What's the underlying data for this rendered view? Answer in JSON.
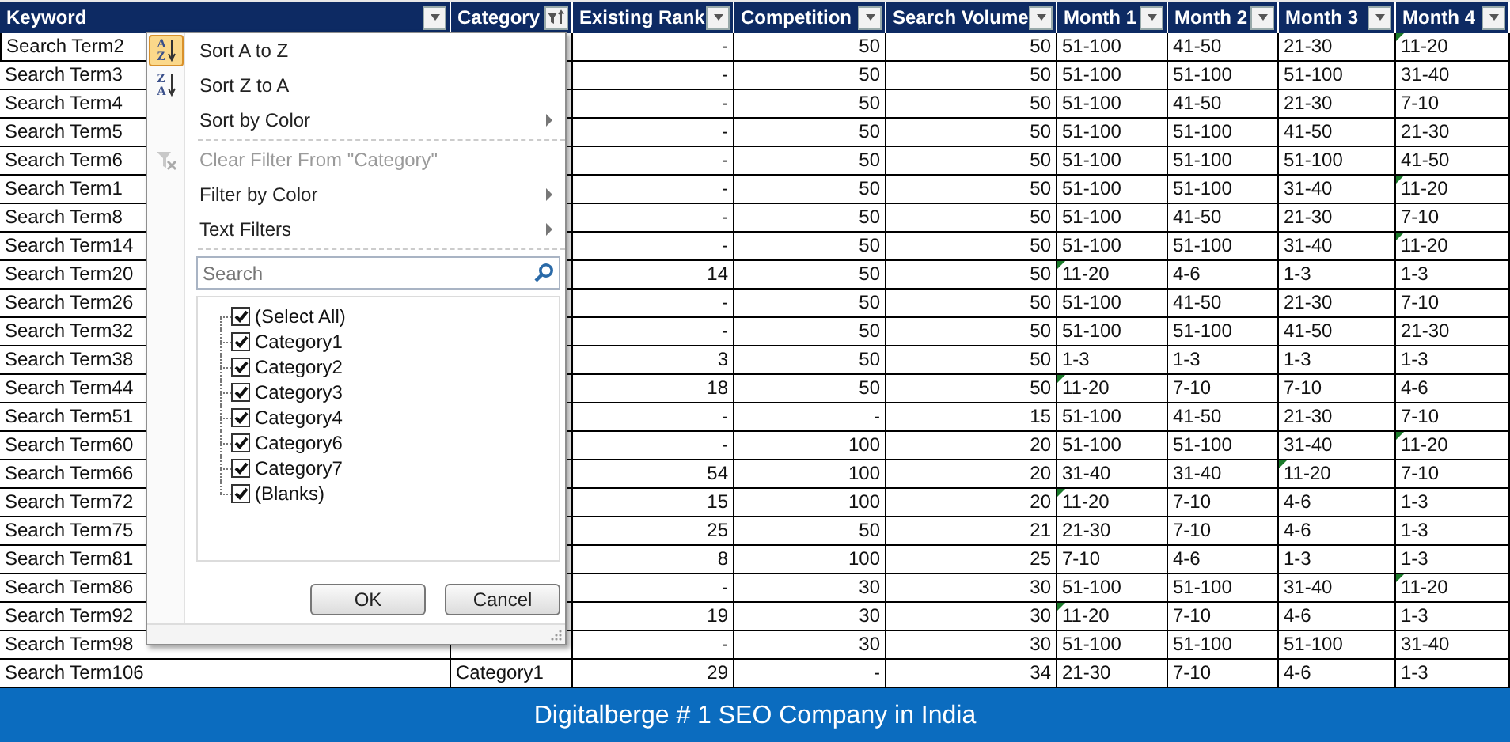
{
  "columns": [
    {
      "label": "Keyword",
      "filtered": false
    },
    {
      "label": "Category",
      "filtered": true
    },
    {
      "label": "Existing Rank",
      "filtered": false
    },
    {
      "label": "Competition",
      "filtered": false
    },
    {
      "label": "Search Volume",
      "filtered": false
    },
    {
      "label": "Month 1",
      "filtered": false
    },
    {
      "label": "Month 2",
      "filtered": false
    },
    {
      "label": "Month 3",
      "filtered": false
    },
    {
      "label": "Month 4",
      "filtered": false
    }
  ],
  "rows": [
    {
      "keyword": "Search Term2",
      "rank": "-",
      "competition": "50",
      "volume": "50",
      "months": [
        {
          "text": "51-100",
          "flagged": false
        },
        {
          "text": "41-50",
          "flagged": false
        },
        {
          "text": "21-30",
          "flagged": false
        },
        {
          "text": "11-20",
          "flagged": true
        }
      ]
    },
    {
      "keyword": "Search Term3",
      "rank": "-",
      "competition": "50",
      "volume": "50",
      "months": [
        {
          "text": "51-100",
          "flagged": false
        },
        {
          "text": "51-100",
          "flagged": false
        },
        {
          "text": "51-100",
          "flagged": false
        },
        {
          "text": "31-40",
          "flagged": false
        }
      ]
    },
    {
      "keyword": "Search Term4",
      "rank": "-",
      "competition": "50",
      "volume": "50",
      "months": [
        {
          "text": "51-100",
          "flagged": false
        },
        {
          "text": "41-50",
          "flagged": false
        },
        {
          "text": "21-30",
          "flagged": false
        },
        {
          "text": "7-10",
          "flagged": false
        }
      ]
    },
    {
      "keyword": "Search Term5",
      "rank": "-",
      "competition": "50",
      "volume": "50",
      "months": [
        {
          "text": "51-100",
          "flagged": false
        },
        {
          "text": "51-100",
          "flagged": false
        },
        {
          "text": "41-50",
          "flagged": false
        },
        {
          "text": "21-30",
          "flagged": false
        }
      ]
    },
    {
      "keyword": "Search Term6",
      "rank": "-",
      "competition": "50",
      "volume": "50",
      "months": [
        {
          "text": "51-100",
          "flagged": false
        },
        {
          "text": "51-100",
          "flagged": false
        },
        {
          "text": "51-100",
          "flagged": false
        },
        {
          "text": "41-50",
          "flagged": false
        }
      ]
    },
    {
      "keyword": "Search Term1",
      "rank": "-",
      "competition": "50",
      "volume": "50",
      "months": [
        {
          "text": "51-100",
          "flagged": false
        },
        {
          "text": "51-100",
          "flagged": false
        },
        {
          "text": "31-40",
          "flagged": false
        },
        {
          "text": "11-20",
          "flagged": true
        }
      ]
    },
    {
      "keyword": "Search Term8",
      "rank": "-",
      "competition": "50",
      "volume": "50",
      "months": [
        {
          "text": "51-100",
          "flagged": false
        },
        {
          "text": "41-50",
          "flagged": false
        },
        {
          "text": "21-30",
          "flagged": false
        },
        {
          "text": "7-10",
          "flagged": false
        }
      ]
    },
    {
      "keyword": "Search Term14",
      "rank": "-",
      "competition": "50",
      "volume": "50",
      "months": [
        {
          "text": "51-100",
          "flagged": false
        },
        {
          "text": "51-100",
          "flagged": false
        },
        {
          "text": "31-40",
          "flagged": false
        },
        {
          "text": "11-20",
          "flagged": true
        }
      ]
    },
    {
      "keyword": "Search Term20",
      "rank": "14",
      "competition": "50",
      "volume": "50",
      "months": [
        {
          "text": "11-20",
          "flagged": true
        },
        {
          "text": "4-6",
          "flagged": false
        },
        {
          "text": "1-3",
          "flagged": false
        },
        {
          "text": "1-3",
          "flagged": false
        }
      ]
    },
    {
      "keyword": "Search Term26",
      "rank": "-",
      "competition": "50",
      "volume": "50",
      "months": [
        {
          "text": "51-100",
          "flagged": false
        },
        {
          "text": "41-50",
          "flagged": false
        },
        {
          "text": "21-30",
          "flagged": false
        },
        {
          "text": "7-10",
          "flagged": false
        }
      ]
    },
    {
      "keyword": "Search Term32",
      "rank": "-",
      "competition": "50",
      "volume": "50",
      "months": [
        {
          "text": "51-100",
          "flagged": false
        },
        {
          "text": "51-100",
          "flagged": false
        },
        {
          "text": "41-50",
          "flagged": false
        },
        {
          "text": "21-30",
          "flagged": false
        }
      ]
    },
    {
      "keyword": "Search Term38",
      "rank": "3",
      "competition": "50",
      "volume": "50",
      "months": [
        {
          "text": "1-3",
          "flagged": false
        },
        {
          "text": "1-3",
          "flagged": false
        },
        {
          "text": "1-3",
          "flagged": false
        },
        {
          "text": "1-3",
          "flagged": false
        }
      ]
    },
    {
      "keyword": "Search Term44",
      "rank": "18",
      "competition": "50",
      "volume": "50",
      "months": [
        {
          "text": "11-20",
          "flagged": true
        },
        {
          "text": "7-10",
          "flagged": false
        },
        {
          "text": "7-10",
          "flagged": false
        },
        {
          "text": "4-6",
          "flagged": false
        }
      ]
    },
    {
      "keyword": "Search Term51",
      "rank": "-",
      "competition": "-",
      "volume": "15",
      "months": [
        {
          "text": "51-100",
          "flagged": false
        },
        {
          "text": "41-50",
          "flagged": false
        },
        {
          "text": "21-30",
          "flagged": false
        },
        {
          "text": "7-10",
          "flagged": false
        }
      ]
    },
    {
      "keyword": "Search Term60",
      "rank": "-",
      "competition": "100",
      "volume": "20",
      "months": [
        {
          "text": "51-100",
          "flagged": false
        },
        {
          "text": "51-100",
          "flagged": false
        },
        {
          "text": "31-40",
          "flagged": false
        },
        {
          "text": "11-20",
          "flagged": true
        }
      ]
    },
    {
      "keyword": "Search Term66",
      "rank": "54",
      "competition": "100",
      "volume": "20",
      "months": [
        {
          "text": "31-40",
          "flagged": false
        },
        {
          "text": "31-40",
          "flagged": false
        },
        {
          "text": "11-20",
          "flagged": true
        },
        {
          "text": "7-10",
          "flagged": false
        }
      ]
    },
    {
      "keyword": "Search Term72",
      "rank": "15",
      "competition": "100",
      "volume": "20",
      "months": [
        {
          "text": "11-20",
          "flagged": true
        },
        {
          "text": "7-10",
          "flagged": false
        },
        {
          "text": "4-6",
          "flagged": false
        },
        {
          "text": "1-3",
          "flagged": false
        }
      ]
    },
    {
      "keyword": "Search Term75",
      "rank": "25",
      "competition": "50",
      "volume": "21",
      "months": [
        {
          "text": "21-30",
          "flagged": false
        },
        {
          "text": "7-10",
          "flagged": false
        },
        {
          "text": "4-6",
          "flagged": false
        },
        {
          "text": "1-3",
          "flagged": false
        }
      ]
    },
    {
      "keyword": "Search Term81",
      "rank": "8",
      "competition": "100",
      "volume": "25",
      "months": [
        {
          "text": "7-10",
          "flagged": false
        },
        {
          "text": "4-6",
          "flagged": false
        },
        {
          "text": "1-3",
          "flagged": false
        },
        {
          "text": "1-3",
          "flagged": false
        }
      ]
    },
    {
      "keyword": "Search Term86",
      "rank": "-",
      "competition": "30",
      "volume": "30",
      "months": [
        {
          "text": "51-100",
          "flagged": false
        },
        {
          "text": "51-100",
          "flagged": false
        },
        {
          "text": "31-40",
          "flagged": false
        },
        {
          "text": "11-20",
          "flagged": true
        }
      ]
    },
    {
      "keyword": "Search Term92",
      "rank": "19",
      "competition": "30",
      "volume": "30",
      "months": [
        {
          "text": "11-20",
          "flagged": true
        },
        {
          "text": "7-10",
          "flagged": false
        },
        {
          "text": "4-6",
          "flagged": false
        },
        {
          "text": "1-3",
          "flagged": false
        }
      ]
    },
    {
      "keyword": "Search Term98",
      "rank": "-",
      "competition": "30",
      "volume": "30",
      "months": [
        {
          "text": "51-100",
          "flagged": false
        },
        {
          "text": "51-100",
          "flagged": false
        },
        {
          "text": "51-100",
          "flagged": false
        },
        {
          "text": "31-40",
          "flagged": false
        }
      ]
    },
    {
      "keyword": "Search Term106",
      "category": "Category1",
      "rank": "29",
      "competition": "-",
      "volume": "34",
      "months": [
        {
          "text": "21-30",
          "flagged": false
        },
        {
          "text": "7-10",
          "flagged": false
        },
        {
          "text": "4-6",
          "flagged": false
        },
        {
          "text": "1-3",
          "flagged": false
        }
      ]
    }
  ],
  "dropdown": {
    "items": [
      {
        "kind": "sort",
        "icon_text": [
          "A",
          "Z"
        ],
        "label": "Sort A to Z",
        "selected": true,
        "disabled": false,
        "submenu": false
      },
      {
        "kind": "sort",
        "icon_text": [
          "Z",
          "A"
        ],
        "label": "Sort Z to A",
        "selected": false,
        "disabled": false,
        "submenu": false
      },
      {
        "kind": "plain",
        "label": "Sort by Color",
        "selected": false,
        "disabled": false,
        "submenu": true
      },
      {
        "kind": "clear",
        "label": "Clear Filter From \"Category\"",
        "selected": false,
        "disabled": true,
        "submenu": false
      },
      {
        "kind": "plain",
        "label": "Filter by Color",
        "selected": false,
        "disabled": false,
        "submenu": true
      },
      {
        "kind": "plain",
        "label": "Text Filters",
        "selected": false,
        "disabled": false,
        "submenu": true
      }
    ],
    "search": {
      "placeholder": "Search"
    },
    "checklist": [
      {
        "label": "(Select All)",
        "checked": true
      },
      {
        "label": "Category1",
        "checked": true
      },
      {
        "label": "Category2",
        "checked": true
      },
      {
        "label": "Category3",
        "checked": true
      },
      {
        "label": "Category4",
        "checked": true
      },
      {
        "label": "Category6",
        "checked": true
      },
      {
        "label": "Category7",
        "checked": true
      },
      {
        "label": "(Blanks)",
        "checked": true
      }
    ],
    "buttons": [
      "OK",
      "Cancel"
    ]
  },
  "footer": {
    "text": "Digitalberge # 1 SEO Company in India"
  }
}
